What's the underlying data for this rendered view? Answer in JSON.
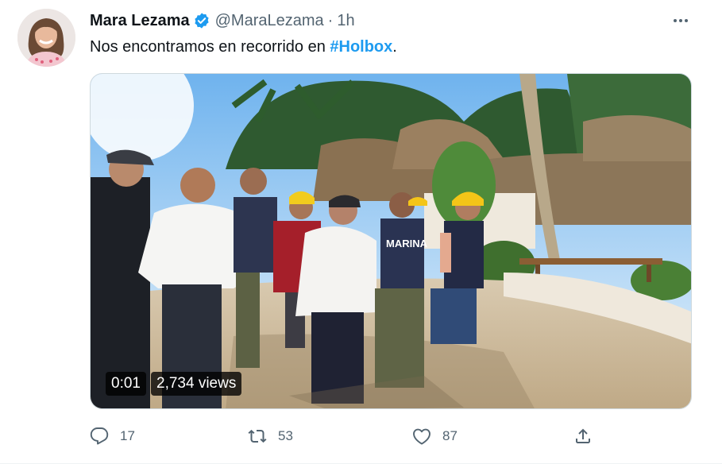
{
  "tweet": {
    "author_name": "Mara Lezama",
    "handle": "@MaraLezama",
    "separator": "·",
    "time": "1h",
    "text_before": "Nos encontramos en recorrido en ",
    "hashtag": "#Holbox",
    "text_after": ".",
    "verified_icon": "verified-badge-icon",
    "more_icon": "more-options-icon"
  },
  "media": {
    "duration": "0:01",
    "views": "2,734 views"
  },
  "actions": {
    "replies": "17",
    "retweets": "53",
    "likes": "87"
  },
  "colors": {
    "accent": "#1d9bf0",
    "secondary_text": "#536471",
    "primary_text": "#0f1419"
  }
}
